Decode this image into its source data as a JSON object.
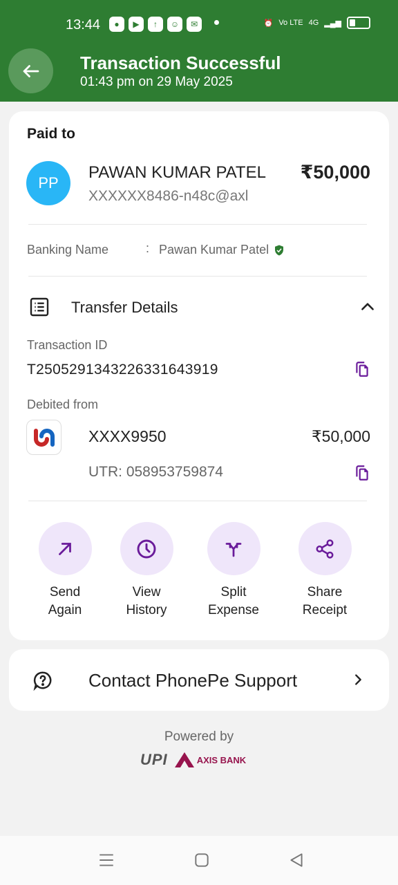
{
  "status_bar": {
    "time": "13:44",
    "network": "4G",
    "volte": "Vo LTE"
  },
  "header": {
    "title": "Transaction Successful",
    "subtitle": "01:43 pm on 29 May 2025"
  },
  "payee": {
    "section_label": "Paid to",
    "initials": "PP",
    "name": "PAWAN KUMAR PATEL",
    "upi_id": "XXXXXX8486-n48c@axl",
    "amount": "₹50,000",
    "avatar_color": "#29b6f6"
  },
  "banking_name": {
    "label": "Banking Name",
    "separator": ":",
    "value": "Pawan Kumar Patel"
  },
  "transfer_details": {
    "title": "Transfer Details",
    "transaction_id_label": "Transaction ID",
    "transaction_id": "T2505291343226331643919",
    "debited_from_label": "Debited from",
    "account": "XXXX9950",
    "amount": "₹50,000",
    "utr": "UTR: 058953759874"
  },
  "actions": [
    {
      "line1": "Send",
      "line2": "Again",
      "icon": "arrow-up-right-icon"
    },
    {
      "line1": "View",
      "line2": "History",
      "icon": "clock-icon"
    },
    {
      "line1": "Split",
      "line2": "Expense",
      "icon": "split-icon"
    },
    {
      "line1": "Share",
      "line2": "Receipt",
      "icon": "share-icon"
    }
  ],
  "support": {
    "label": "Contact PhonePe Support"
  },
  "footer": {
    "powered_by": "Powered by",
    "upi_logo": "UPI",
    "bank_logo": "AXIS BANK"
  },
  "colors": {
    "header_green": "#2e7d32",
    "accent_purple": "#6a1b9a",
    "action_bg": "#efe6fa"
  }
}
